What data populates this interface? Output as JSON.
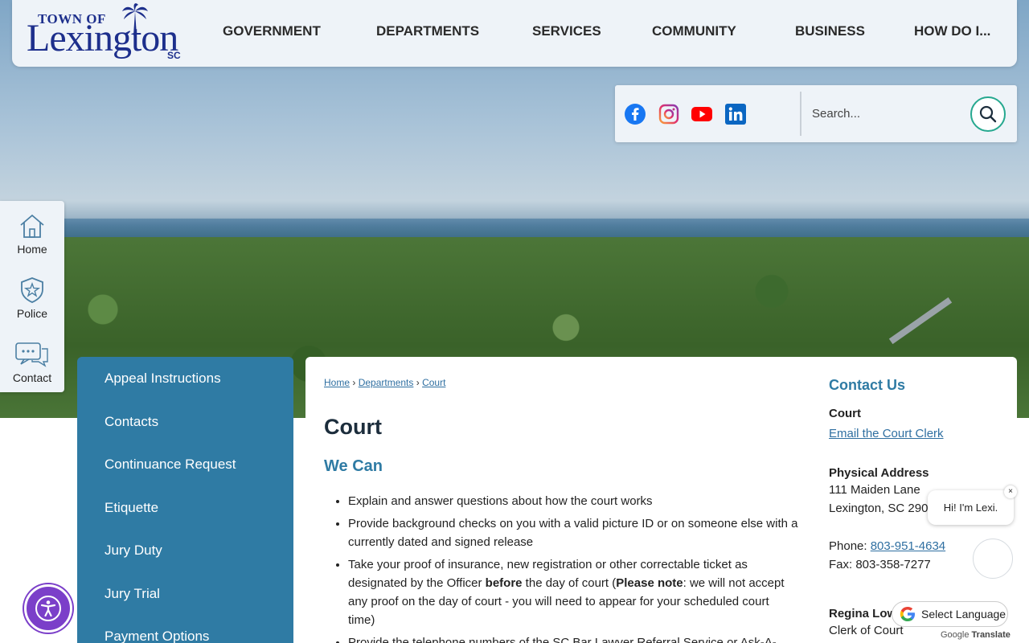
{
  "logo": {
    "line1": "TOWN OF",
    "line2": "Lexington",
    "line3": "SC"
  },
  "nav": [
    {
      "label": "GOVERNMENT"
    },
    {
      "label": "DEPARTMENTS"
    },
    {
      "label": "SERVICES"
    },
    {
      "label": "COMMUNITY"
    },
    {
      "label": "BUSINESS"
    },
    {
      "label": "HOW DO I..."
    }
  ],
  "social": [
    "facebook-icon",
    "instagram-icon",
    "youtube-icon",
    "linkedin-icon"
  ],
  "search": {
    "placeholder": "Search..."
  },
  "quicklinks": [
    {
      "label": "Home",
      "icon": "home-icon"
    },
    {
      "label": "Police",
      "icon": "police-badge-icon"
    },
    {
      "label": "Contact",
      "icon": "chat-bubble-icon"
    }
  ],
  "sidemenu": [
    {
      "label": "Appeal Instructions"
    },
    {
      "label": "Contacts"
    },
    {
      "label": "Continuance Request"
    },
    {
      "label": "Etiquette"
    },
    {
      "label": "Jury Duty"
    },
    {
      "label": "Jury Trial"
    },
    {
      "label": "Payment Options"
    }
  ],
  "breadcrumb": {
    "home": "Home",
    "departments": "Departments",
    "court": "Court"
  },
  "page": {
    "title": "Court",
    "subhead": "We Can",
    "bullets": [
      "Explain and answer questions about how the court works",
      "Provide background checks on you with a valid picture ID or on someone else with a currently dated and signed release",
      "Take your proof of insurance, new registration or other correctable ticket as designated by the Officer",
      "Provide the telephone numbers of the SC Bar Lawyer Referral Service or Ask-A-"
    ],
    "bullet3_before": "before",
    "bullet3_mid": " the day of court (",
    "bullet3_note": "Please note",
    "bullet3_end": ": we will not accept any proof on the day of court - you will need to appear for your scheduled court time)"
  },
  "contact": {
    "heading": "Contact Us",
    "dept": "Court",
    "email_link": "Email the Court Clerk",
    "address_label": "Physical Address",
    "address_line1": "111 Maiden Lane",
    "address_line2": "Lexington, SC 290",
    "phone_label": "Phone: ",
    "phone": "803-951-4634",
    "fax": "Fax: 803-358-7277",
    "person": "Regina Lowe",
    "person_title": "Clerk of Court"
  },
  "chat": {
    "greeting": "Hi! I'm Lexi.",
    "close": "×"
  },
  "translate": {
    "label": "Select Language",
    "powered_google": "Google",
    "powered_translate": "Translate"
  },
  "colors": {
    "accent": "#2f7ba4",
    "nav_bg": "#eef3f8",
    "access": "#7b3fc9",
    "search_ring": "#26a88f"
  }
}
